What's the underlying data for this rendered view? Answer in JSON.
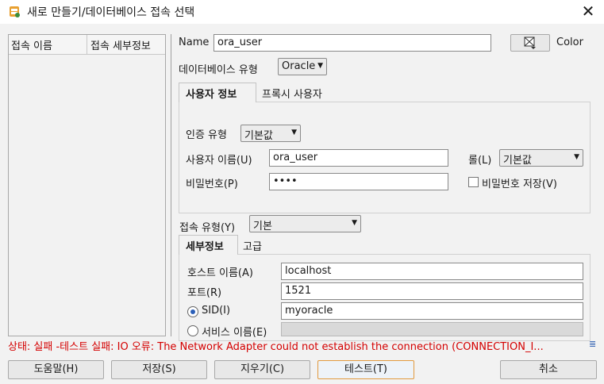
{
  "window": {
    "title": "새로 만들기/데이터베이스 접속 선택",
    "close_glyph": "✕"
  },
  "connections_list": {
    "columns": [
      "접속 이름",
      "접속 세부정보"
    ]
  },
  "form": {
    "name_label": "Name",
    "name_value": "ora_user",
    "color_label": "Color",
    "db_type_label": "데이터베이스 유형",
    "db_type_value": "Oracle",
    "tabs": [
      "사용자 정보",
      "프록시 사용자"
    ],
    "auth_type_label": "인증 유형",
    "auth_type_value": "기본값",
    "username_label": "사용자 이름(U)",
    "username_value": "ora_user",
    "role_label": "롤(L)",
    "role_value": "기본값",
    "password_label": "비밀번호(P)",
    "password_value": "••••",
    "save_password_label": "비밀번호 저장(V)",
    "save_password_checked": false,
    "connection_type_label": "접속 유형(Y)",
    "connection_type_value": "기본",
    "detail_tabs": [
      "세부정보",
      "고급"
    ],
    "host_label": "호스트 이름(A)",
    "host_value": "localhost",
    "port_label": "포트(R)",
    "port_value": "1521",
    "sid_label": "SID(I)",
    "sid_value": "myoracle",
    "sid_selected": true,
    "service_label": "서비스 이름(E)",
    "service_value": ""
  },
  "status": {
    "text": "상태: 실패 -테스트 실패: IO 오류: The Network Adapter could not establish the connection (CONNECTION_I...",
    "more_icon": "≣"
  },
  "buttons": {
    "help": "도움말(H)",
    "save": "저장(S)",
    "clear": "지우기(C)",
    "test": "테스트(T)",
    "cancel": "취소"
  },
  "colors": {
    "error": "#d40000",
    "focus_border": "#e29a3f"
  }
}
